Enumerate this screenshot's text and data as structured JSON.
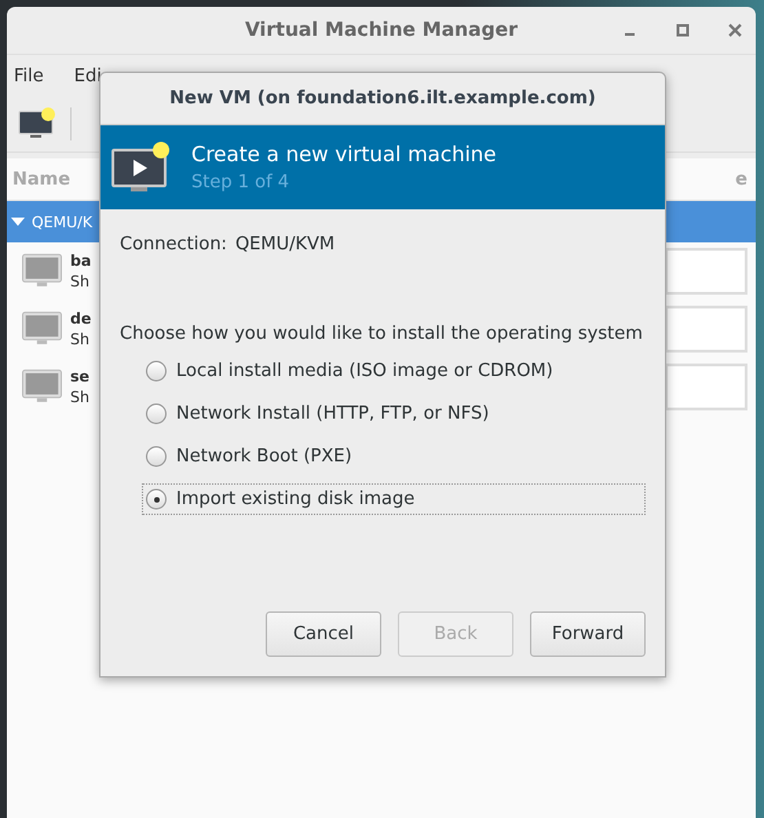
{
  "window": {
    "title": "Virtual Machine Manager"
  },
  "menu": [
    "File",
    "Edi"
  ],
  "list": {
    "column_1": "Name",
    "column_2": "e",
    "group": {
      "label": "QEMU/K",
      "expanded": true,
      "selected": true
    },
    "vms": [
      {
        "name": "ba",
        "status": "Sh"
      },
      {
        "name": "de",
        "status": "Sh"
      },
      {
        "name": "se",
        "status": "Sh"
      }
    ]
  },
  "dialog": {
    "title": "New VM (on foundation6.ilt.example.com)",
    "heading": "Create a new virtual machine",
    "step": "Step 1 of 4",
    "connection_label": "Connection:",
    "connection": "QEMU/KVM",
    "prompt": "Choose how you would like to install the operating system",
    "options": [
      {
        "label": "Local install media (ISO image or CDROM)",
        "selected": false
      },
      {
        "label": "Network Install (HTTP, FTP, or NFS)",
        "selected": false
      },
      {
        "label": "Network Boot (PXE)",
        "selected": false
      },
      {
        "label": "Import existing disk image",
        "selected": true
      }
    ],
    "buttons": [
      {
        "label": "Cancel",
        "disabled": false
      },
      {
        "label": "Back",
        "disabled": true
      },
      {
        "label": "Forward",
        "disabled": false
      }
    ]
  }
}
